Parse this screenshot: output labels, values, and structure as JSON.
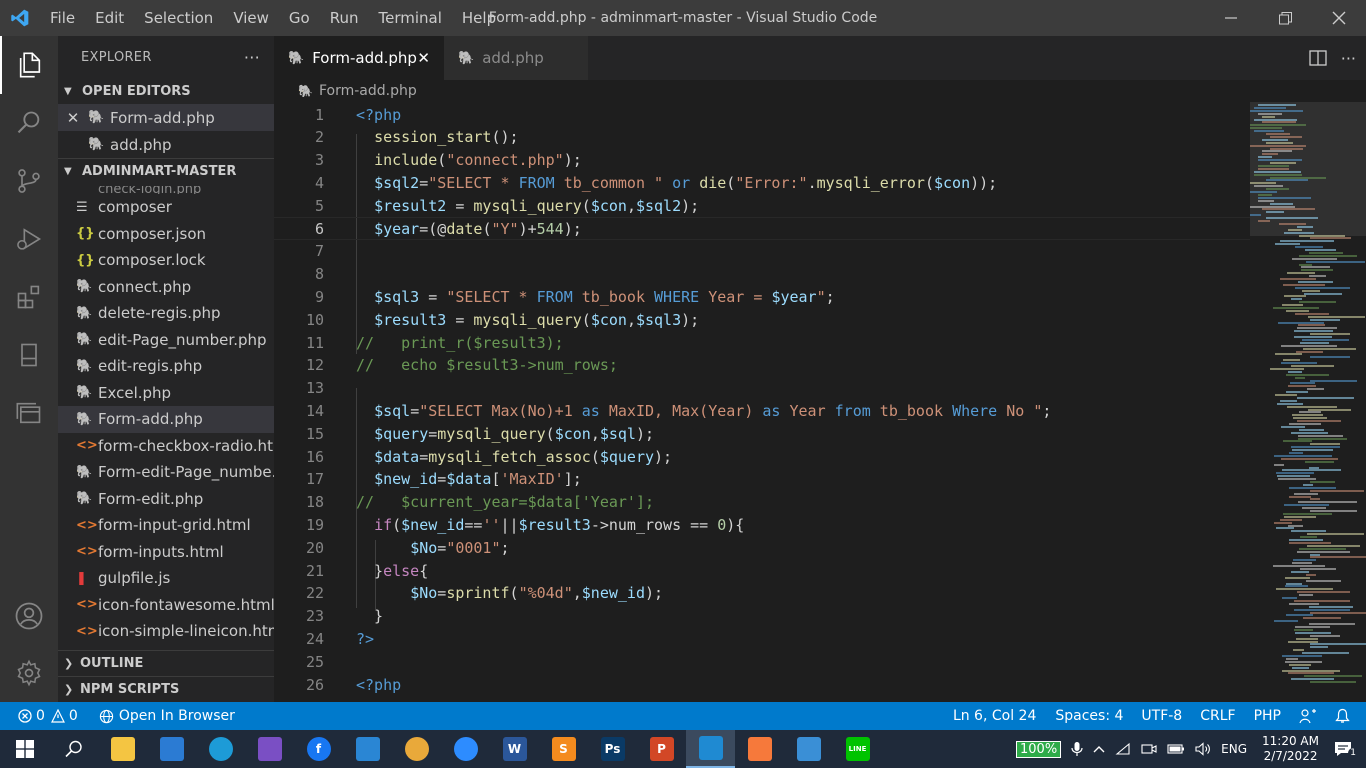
{
  "window": {
    "title": "Form-add.php - adminmart-master - Visual Studio Code",
    "menu": [
      "File",
      "Edit",
      "Selection",
      "View",
      "Go",
      "Run",
      "Terminal",
      "Help"
    ]
  },
  "activity_bar": {
    "icons": [
      "files-icon",
      "search-icon",
      "source-control-icon",
      "run-debug-icon",
      "extensions-icon",
      "remote-icon",
      "layers-icon",
      "account-icon",
      "settings-gear-icon"
    ]
  },
  "sidebar": {
    "header": "EXPLORER",
    "open_editors": {
      "title": "OPEN EDITORS",
      "items": [
        {
          "name": "Form-add.php",
          "icon": "php-icon"
        },
        {
          "name": "add.php",
          "icon": "php-icon"
        }
      ]
    },
    "project": {
      "title": "ADMINMART-MASTER",
      "partial_top": "check-login.php",
      "files": [
        {
          "name": "composer",
          "icon": "file-icon"
        },
        {
          "name": "composer.json",
          "icon": "json-icon"
        },
        {
          "name": "composer.lock",
          "icon": "json-icon"
        },
        {
          "name": "connect.php",
          "icon": "php-icon"
        },
        {
          "name": "delete-regis.php",
          "icon": "php-icon"
        },
        {
          "name": "edit-Page_number.php",
          "icon": "php-icon"
        },
        {
          "name": "edit-regis.php",
          "icon": "php-icon"
        },
        {
          "name": "Excel.php",
          "icon": "php-icon"
        },
        {
          "name": "Form-add.php",
          "icon": "php-icon"
        },
        {
          "name": "form-checkbox-radio.ht...",
          "icon": "html-icon"
        },
        {
          "name": "Form-edit-Page_numbe...",
          "icon": "php-icon"
        },
        {
          "name": "Form-edit.php",
          "icon": "php-icon"
        },
        {
          "name": "form-input-grid.html",
          "icon": "html-icon"
        },
        {
          "name": "form-inputs.html",
          "icon": "html-icon"
        },
        {
          "name": "gulpfile.js",
          "icon": "gulp-icon"
        },
        {
          "name": "icon-fontawesome.html",
          "icon": "html-icon"
        },
        {
          "name": "icon-simple-lineicon.html",
          "icon": "html-icon"
        }
      ]
    },
    "outline": "OUTLINE",
    "npm_scripts": "NPM SCRIPTS"
  },
  "editor": {
    "tabs": [
      {
        "label": "Form-add.php",
        "active": true
      },
      {
        "label": "add.php",
        "active": false
      }
    ],
    "breadcrumb": "Form-add.php",
    "lines": [
      {
        "n": "1",
        "code": "<?php"
      },
      {
        "n": "2",
        "code": "  session_start();"
      },
      {
        "n": "3",
        "code": "  include(\"connect.php\");"
      },
      {
        "n": "4",
        "code": "  $sql2=\"SELECT * FROM tb_common \" or die(\"Error:\".mysqli_error($con));"
      },
      {
        "n": "5",
        "code": "  $result2 = mysqli_query($con,$sql2);"
      },
      {
        "n": "6",
        "code": "  $year=(@date(\"Y\")+544);"
      },
      {
        "n": "7",
        "code": ""
      },
      {
        "n": "8",
        "code": ""
      },
      {
        "n": "9",
        "code": "  $sql3 = \"SELECT * FROM tb_book WHERE Year = $year\";"
      },
      {
        "n": "10",
        "code": "  $result3 = mysqli_query($con,$sql3);"
      },
      {
        "n": "11",
        "code": "//   print_r($result3);"
      },
      {
        "n": "12",
        "code": "//   echo $result3->num_rows;"
      },
      {
        "n": "13",
        "code": ""
      },
      {
        "n": "14",
        "code": "  $sql=\"SELECT Max(No)+1 as MaxID, Max(Year) as Year from tb_book Where No \";"
      },
      {
        "n": "15",
        "code": "  $query=mysqli_query($con,$sql);"
      },
      {
        "n": "16",
        "code": "  $data=mysqli_fetch_assoc($query);"
      },
      {
        "n": "17",
        "code": "  $new_id=$data['MaxID'];"
      },
      {
        "n": "18",
        "code": "//   $current_year=$data['Year'];"
      },
      {
        "n": "19",
        "code": "  if($new_id==''||$result3->num_rows == 0){"
      },
      {
        "n": "20",
        "code": "      $No=\"0001\";"
      },
      {
        "n": "21",
        "code": "  }else{"
      },
      {
        "n": "22",
        "code": "      $No=sprintf(\"%04d\",$new_id);"
      },
      {
        "n": "23",
        "code": "  }"
      },
      {
        "n": "24",
        "code": "?>"
      },
      {
        "n": "25",
        "code": ""
      },
      {
        "n": "26",
        "code": "<?php"
      }
    ]
  },
  "statusbar": {
    "errors": "0",
    "warnings": "0",
    "open_in_browser": "Open In Browser",
    "position": "Ln 6, Col 24",
    "spaces": "Spaces: 4",
    "encoding": "UTF-8",
    "eol": "CRLF",
    "language": "PHP"
  },
  "taskbar": {
    "apps": [
      {
        "name": "file-explorer",
        "label": ""
      },
      {
        "name": "store",
        "label": ""
      },
      {
        "name": "edge",
        "label": ""
      },
      {
        "name": "visual-studio",
        "label": ""
      },
      {
        "name": "facebook",
        "label": "f"
      },
      {
        "name": "mail",
        "label": ""
      },
      {
        "name": "chrome",
        "label": ""
      },
      {
        "name": "zoom",
        "label": ""
      },
      {
        "name": "word",
        "label": "W"
      },
      {
        "name": "sublime",
        "label": "S"
      },
      {
        "name": "photoshop",
        "label": "Ps"
      },
      {
        "name": "powerpoint",
        "label": "P"
      },
      {
        "name": "vscode",
        "label": ""
      },
      {
        "name": "xampp",
        "label": ""
      },
      {
        "name": "control-panel",
        "label": ""
      },
      {
        "name": "line",
        "label": "LINE"
      }
    ],
    "battery": "100%",
    "battery_level": 1.0,
    "language": "ENG",
    "time": "11:20 AM",
    "date": "2/7/2022",
    "notifications": "1"
  },
  "colors": {
    "accent": "#007acc",
    "php_icon": "#a074c4",
    "html_icon": "#e37933",
    "json_icon": "#cbcb41"
  }
}
